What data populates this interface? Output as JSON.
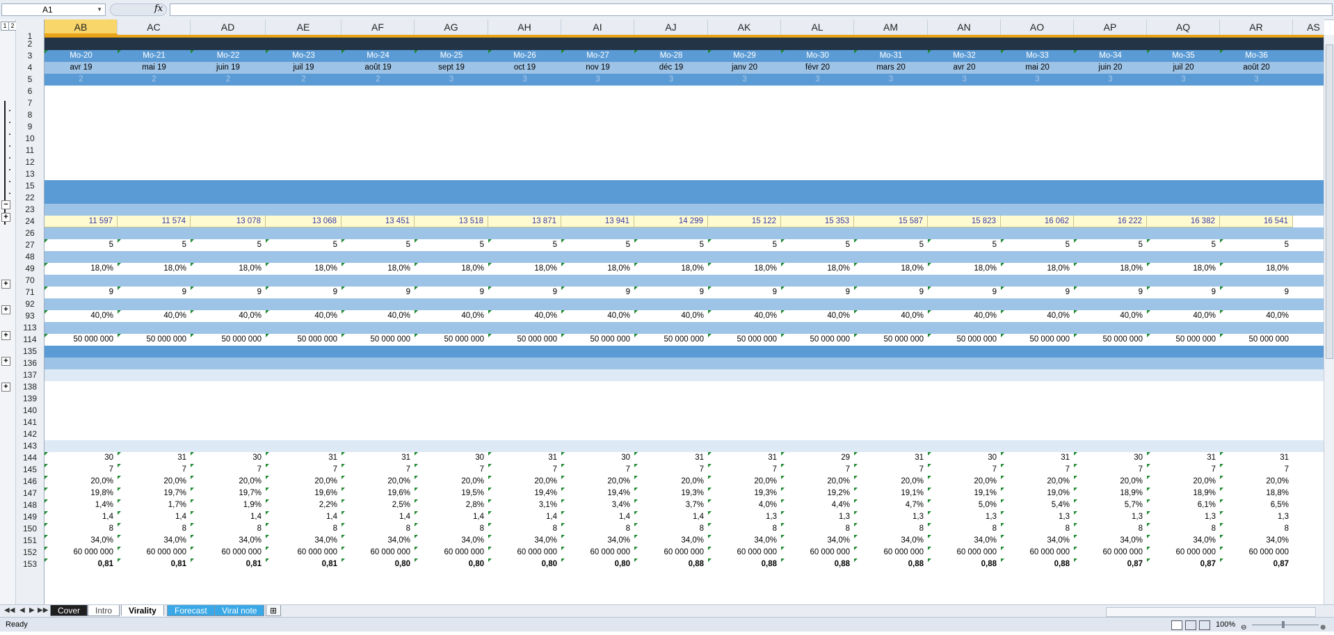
{
  "formula_bar": {
    "name_box": "A1",
    "fx_label": "fx",
    "formula": ""
  },
  "outline_levels": [
    "1",
    "2"
  ],
  "columns": [
    "AB",
    "AC",
    "AD",
    "AE",
    "AF",
    "AG",
    "AH",
    "AI",
    "AJ",
    "AK",
    "AL",
    "AM",
    "AN",
    "AO",
    "AP",
    "AQ",
    "AR",
    "AS"
  ],
  "row_numbers": [
    "1",
    "2",
    "3",
    "4",
    "5",
    "6",
    "7",
    "8",
    "9",
    "10",
    "11",
    "12",
    "13",
    "15",
    "22",
    "23",
    "24",
    "26",
    "27",
    "48",
    "49",
    "70",
    "71",
    "92",
    "93",
    "113",
    "114",
    "135",
    "136",
    "137",
    "138",
    "139",
    "140",
    "141",
    "142",
    "143",
    "144",
    "145",
    "146",
    "147",
    "148",
    "149",
    "150",
    "151",
    "152",
    "153"
  ],
  "rows": {
    "r3": [
      "Mo-20",
      "Mo-21",
      "Mo-22",
      "Mo-23",
      "Mo-24",
      "Mo-25",
      "Mo-26",
      "Mo-27",
      "Mo-28",
      "Mo-29",
      "Mo-30",
      "Mo-31",
      "Mo-32",
      "Mo-33",
      "Mo-34",
      "Mo-35",
      "Mo-36"
    ],
    "r4": [
      "avr 19",
      "mai 19",
      "juin 19",
      "juil 19",
      "août 19",
      "sept 19",
      "oct 19",
      "nov 19",
      "déc 19",
      "janv 20",
      "févr 20",
      "mars 20",
      "avr 20",
      "mai 20",
      "juin 20",
      "juil 20",
      "août 20"
    ],
    "r5": [
      "2",
      "2",
      "2",
      "2",
      "2",
      "3",
      "3",
      "3",
      "3",
      "3",
      "3",
      "3",
      "3",
      "3",
      "3",
      "3",
      "3"
    ],
    "r24": [
      "11 597",
      "11 574",
      "13 078",
      "13 068",
      "13 451",
      "13 518",
      "13 871",
      "13 941",
      "14 299",
      "15 122",
      "15 353",
      "15 587",
      "15 823",
      "16 062",
      "16 222",
      "16 382",
      "16 541"
    ],
    "r27": [
      "5",
      "5",
      "5",
      "5",
      "5",
      "5",
      "5",
      "5",
      "5",
      "5",
      "5",
      "5",
      "5",
      "5",
      "5",
      "5",
      "5"
    ],
    "r49": [
      "18,0%",
      "18,0%",
      "18,0%",
      "18,0%",
      "18,0%",
      "18,0%",
      "18,0%",
      "18,0%",
      "18,0%",
      "18,0%",
      "18,0%",
      "18,0%",
      "18,0%",
      "18,0%",
      "18,0%",
      "18,0%",
      "18,0%"
    ],
    "r71": [
      "9",
      "9",
      "9",
      "9",
      "9",
      "9",
      "9",
      "9",
      "9",
      "9",
      "9",
      "9",
      "9",
      "9",
      "9",
      "9",
      "9"
    ],
    "r93": [
      "40,0%",
      "40,0%",
      "40,0%",
      "40,0%",
      "40,0%",
      "40,0%",
      "40,0%",
      "40,0%",
      "40,0%",
      "40,0%",
      "40,0%",
      "40,0%",
      "40,0%",
      "40,0%",
      "40,0%",
      "40,0%",
      "40,0%"
    ],
    "r114": [
      "50 000 000",
      "50 000 000",
      "50 000 000",
      "50 000 000",
      "50 000 000",
      "50 000 000",
      "50 000 000",
      "50 000 000",
      "50 000 000",
      "50 000 000",
      "50 000 000",
      "50 000 000",
      "50 000 000",
      "50 000 000",
      "50 000 000",
      "50 000 000",
      "50 000 000"
    ],
    "r144": [
      "30",
      "31",
      "30",
      "31",
      "31",
      "30",
      "31",
      "30",
      "31",
      "31",
      "29",
      "31",
      "30",
      "31",
      "30",
      "31",
      "31"
    ],
    "r145": [
      "7",
      "7",
      "7",
      "7",
      "7",
      "7",
      "7",
      "7",
      "7",
      "7",
      "7",
      "7",
      "7",
      "7",
      "7",
      "7",
      "7"
    ],
    "r146": [
      "20,0%",
      "20,0%",
      "20,0%",
      "20,0%",
      "20,0%",
      "20,0%",
      "20,0%",
      "20,0%",
      "20,0%",
      "20,0%",
      "20,0%",
      "20,0%",
      "20,0%",
      "20,0%",
      "20,0%",
      "20,0%",
      "20,0%"
    ],
    "r147": [
      "19,8%",
      "19,7%",
      "19,7%",
      "19,6%",
      "19,6%",
      "19,5%",
      "19,4%",
      "19,4%",
      "19,3%",
      "19,3%",
      "19,2%",
      "19,1%",
      "19,1%",
      "19,0%",
      "18,9%",
      "18,9%",
      "18,8%"
    ],
    "r148": [
      "1,4%",
      "1,7%",
      "1,9%",
      "2,2%",
      "2,5%",
      "2,8%",
      "3,1%",
      "3,4%",
      "3,7%",
      "4,0%",
      "4,4%",
      "4,7%",
      "5,0%",
      "5,4%",
      "5,7%",
      "6,1%",
      "6,5%"
    ],
    "r149": [
      "1,4",
      "1,4",
      "1,4",
      "1,4",
      "1,4",
      "1,4",
      "1,4",
      "1,4",
      "1,4",
      "1,3",
      "1,3",
      "1,3",
      "1,3",
      "1,3",
      "1,3",
      "1,3",
      "1,3"
    ],
    "r150": [
      "8",
      "8",
      "8",
      "8",
      "8",
      "8",
      "8",
      "8",
      "8",
      "8",
      "8",
      "8",
      "8",
      "8",
      "8",
      "8",
      "8"
    ],
    "r151": [
      "34,0%",
      "34,0%",
      "34,0%",
      "34,0%",
      "34,0%",
      "34,0%",
      "34,0%",
      "34,0%",
      "34,0%",
      "34,0%",
      "34,0%",
      "34,0%",
      "34,0%",
      "34,0%",
      "34,0%",
      "34,0%",
      "34,0%"
    ],
    "r152": [
      "60 000 000",
      "60 000 000",
      "60 000 000",
      "60 000 000",
      "60 000 000",
      "60 000 000",
      "60 000 000",
      "60 000 000",
      "60 000 000",
      "60 000 000",
      "60 000 000",
      "60 000 000",
      "60 000 000",
      "60 000 000",
      "60 000 000",
      "60 000 000",
      "60 000 000"
    ],
    "r153": [
      "0,81",
      "0,81",
      "0,81",
      "0,81",
      "0,80",
      "0,80",
      "0,80",
      "0,80",
      "0,88",
      "0,88",
      "0,88",
      "0,88",
      "0,88",
      "0,88",
      "0,87",
      "0,87",
      "0,87"
    ]
  },
  "sheet_tabs": [
    {
      "label": "Cover",
      "active": false,
      "color": "#1f1f1f",
      "text": "#ffffff"
    },
    {
      "label": "Intro",
      "active": false,
      "color": "#ffffff",
      "text": "#444444"
    },
    {
      "label": "Virality",
      "active": true,
      "color": "#ffffff",
      "text": "#000000"
    },
    {
      "label": "Forecast",
      "active": false,
      "color": "#3aa8e6",
      "text": "#ffffff"
    },
    {
      "label": "Viral note",
      "active": false,
      "color": "#3aa8e6",
      "text": "#ffffff"
    }
  ],
  "status": {
    "left": "Ready",
    "zoom": "100%"
  },
  "colors": {
    "dark_band": "#243447",
    "header_blue": "#5b9bd5",
    "light_blue": "#9dc3e6",
    "pale_blue": "#dde9f5",
    "yellow_row": "#fffbd0",
    "blue_text": "#3a3aa8",
    "selected_col": "#f9d66a",
    "accent_orange": "#e8a317"
  }
}
